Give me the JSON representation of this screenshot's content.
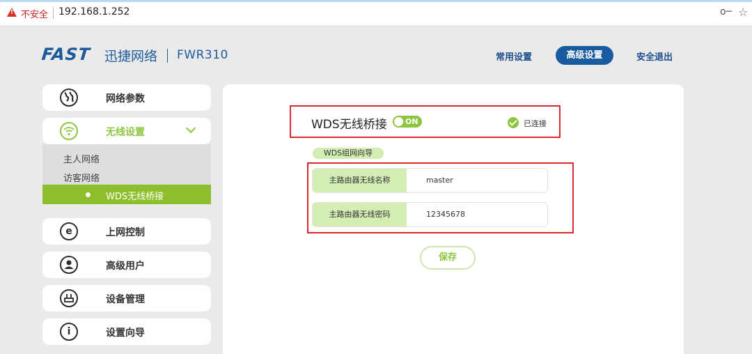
{
  "browser": {
    "security_label": "不安全",
    "url": "192.168.1.252"
  },
  "header": {
    "brand": "FAST",
    "brand_cn": "迅捷网络",
    "model": "FWR310",
    "nav": {
      "common": "常用设置",
      "advanced": "高级设置",
      "logout": "安全退出"
    }
  },
  "sidebar": {
    "items": [
      {
        "label": "网络参数",
        "icon": "globe-icon"
      },
      {
        "label": "无线设置",
        "icon": "wifi-icon",
        "expanded": true
      },
      {
        "label": "上网控制",
        "icon": "internet-e-icon"
      },
      {
        "label": "高级用户",
        "icon": "user-icon"
      },
      {
        "label": "设备管理",
        "icon": "router-icon"
      },
      {
        "label": "设置向导",
        "icon": "info-icon"
      }
    ],
    "subitems": [
      {
        "label": "主人网络"
      },
      {
        "label": "访客网络"
      },
      {
        "label": "WDS无线桥接",
        "active": true
      }
    ]
  },
  "main": {
    "title": "WDS无线桥接",
    "toggle_label": "ON",
    "toggle_on": true,
    "status": "已连接",
    "guide_tag": "WDS组网向导",
    "fields": [
      {
        "label": "主路由器无线名称",
        "value": "master"
      },
      {
        "label": "主路由器无线密码",
        "value": "12345678"
      }
    ],
    "save_label": "保存"
  },
  "colors": {
    "accent_green": "#8cc63f",
    "brand_blue": "#1a5aa0",
    "highlight_red": "#d9282f"
  }
}
